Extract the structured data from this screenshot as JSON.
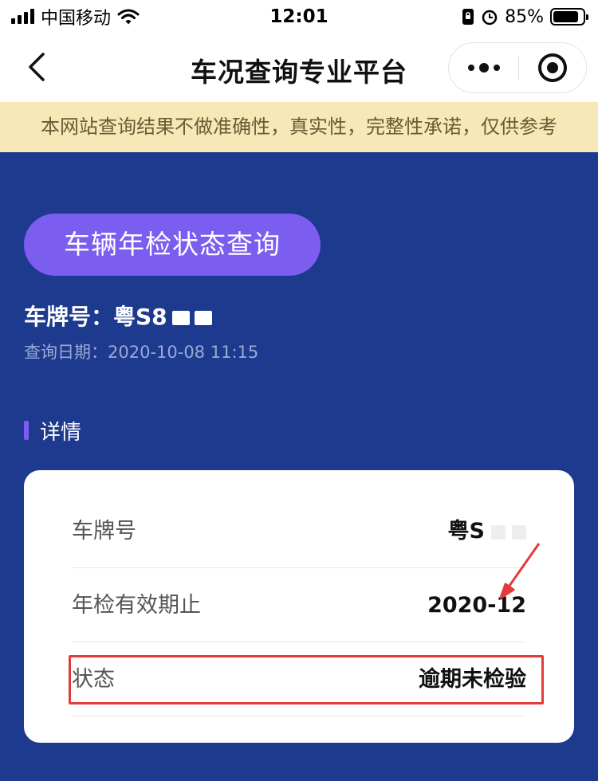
{
  "status_bar": {
    "carrier": "中国移动",
    "time": "12:01",
    "battery_percent": "85%",
    "battery_level": 0.85
  },
  "nav": {
    "title": "车况查询专业平台"
  },
  "notice": {
    "text": "本网站查询结果不做准确性，真实性，完整性承诺，仅供参考"
  },
  "query": {
    "button_label": "车辆年检状态查询",
    "plate_label": "车牌号：",
    "plate_value": "粤S8",
    "date_label": "查询日期：",
    "date_value": "2020-10-08 11:15"
  },
  "details": {
    "section_title": "详情",
    "rows": [
      {
        "label": "车牌号",
        "value": "粤S"
      },
      {
        "label": "年检有效期止",
        "value": "2020-12"
      },
      {
        "label": "状态",
        "value": "逾期未检验"
      }
    ]
  },
  "colors": {
    "page_background": "#1d3a8f",
    "accent_purple": "#7b5df0",
    "notice_background": "#f7e8b8",
    "annotation_red": "#e23b3b"
  }
}
